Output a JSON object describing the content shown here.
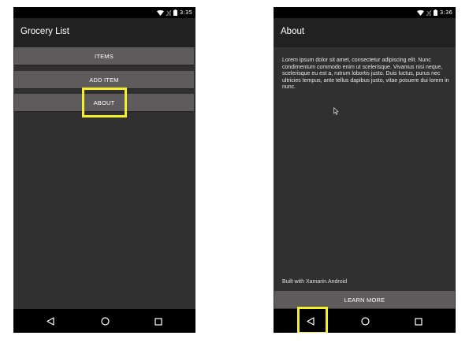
{
  "status_bar": {
    "time_left": "3:35",
    "time_right": "3:36",
    "icons": [
      "wifi-icon",
      "no-signal-icon",
      "battery-icon"
    ]
  },
  "screen_left": {
    "title": "Grocery List",
    "buttons": {
      "items": "ITEMS",
      "add_item": "ADD ITEM",
      "about": "ABOUT"
    }
  },
  "screen_right": {
    "title": "About",
    "body": "Lorem ipsum dolor sit amet, consectetur adipiscing elit. Nunc condimentum commodo enim ut scelerisque. Vivamus nisi neque, scelerisque eu est a, rutrum lobortis justo. Duis luctus, purus nec ultricies tempus, ante tellus dapibus justo, vitae posuere dui lorem in nunc.",
    "footer_label": "Built with Xamarin.Android",
    "learn_more": "LEARN MORE"
  },
  "nav_bar": {
    "buttons": [
      "back-icon",
      "home-icon",
      "recents-icon"
    ]
  },
  "colors": {
    "highlight": "#f5ee2a",
    "screen_bg": "#303030",
    "toolbar_bg": "#212121",
    "button_bg": "#5d5b5b"
  }
}
